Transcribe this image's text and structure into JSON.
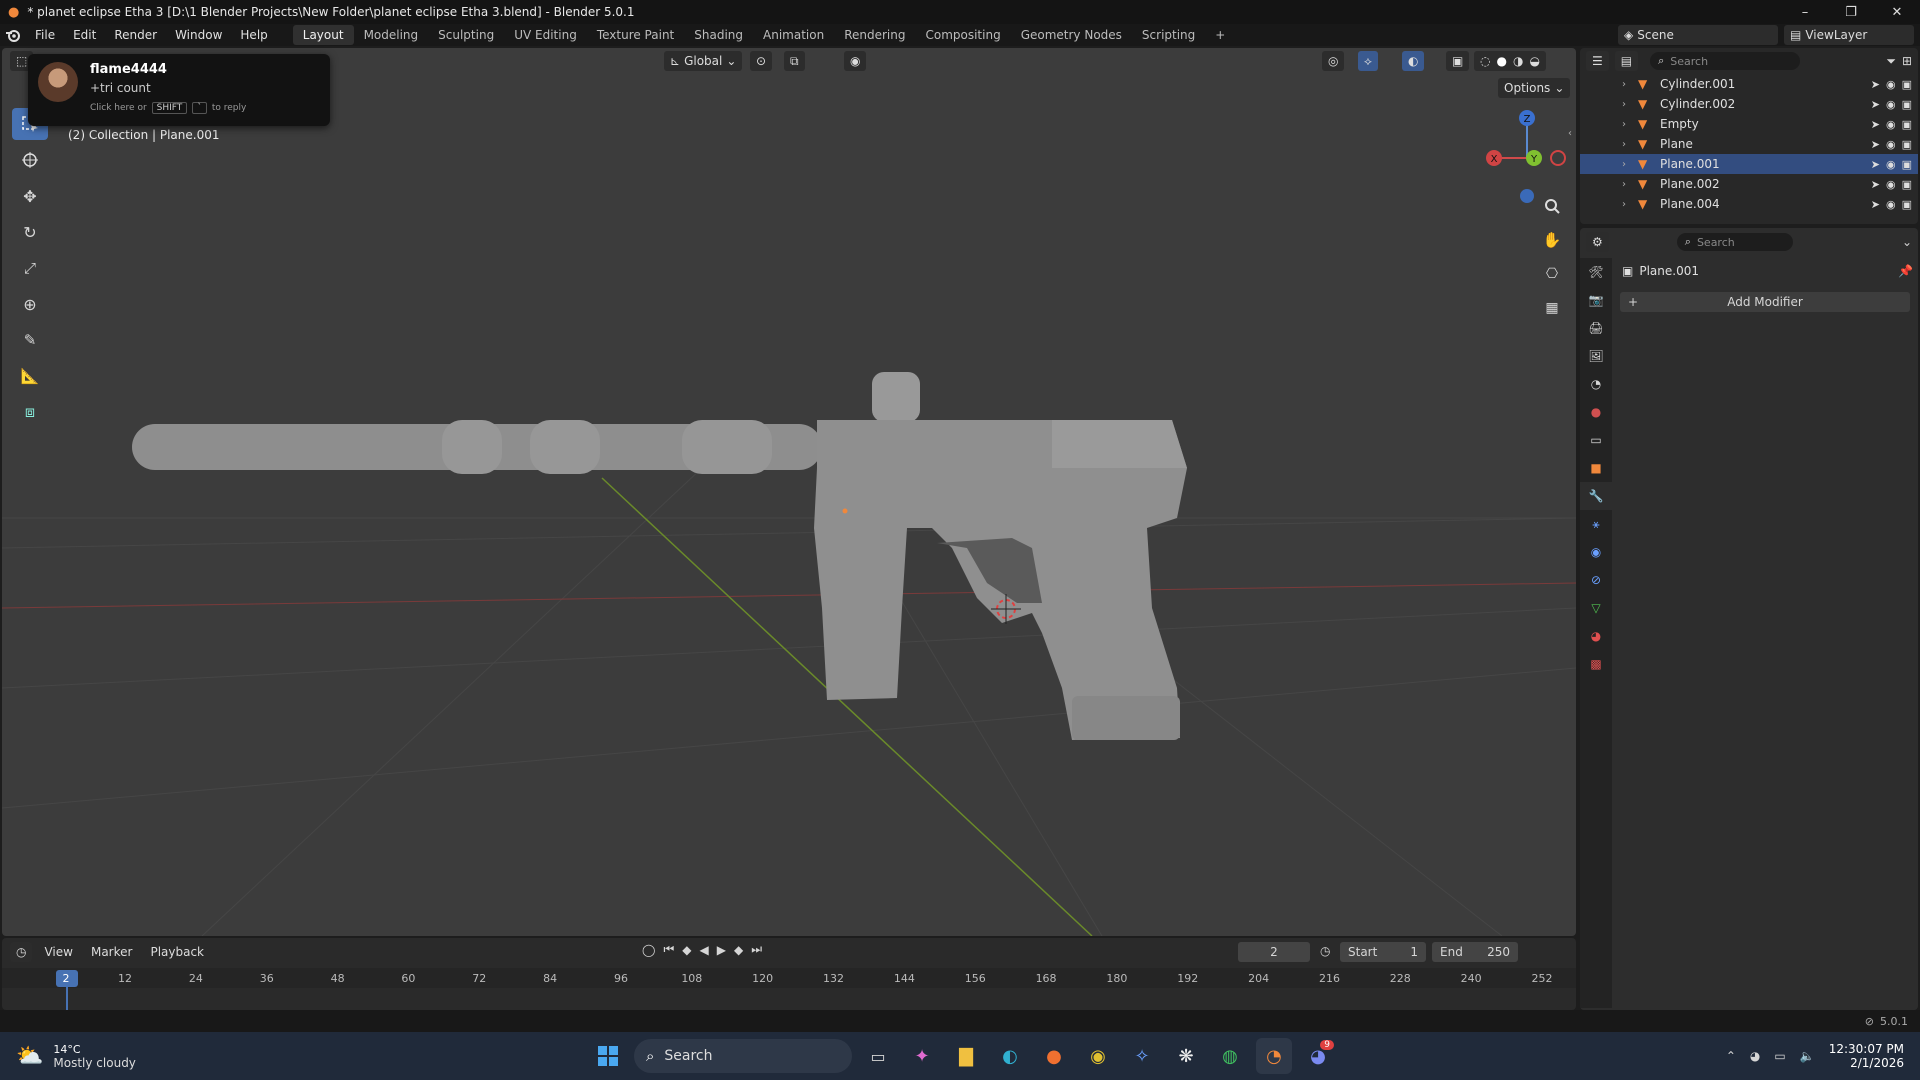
{
  "window": {
    "title": "* planet eclipse Etha 3 [D:\\1 Blender Projects\\New Folder\\planet eclipse Etha 3.blend] - Blender 5.0.1"
  },
  "menu": {
    "items": [
      "File",
      "Edit",
      "Render",
      "Window",
      "Help"
    ]
  },
  "workspaces": {
    "tabs": [
      "Layout",
      "Modeling",
      "Sculpting",
      "UV Editing",
      "Texture Paint",
      "Shading",
      "Animation",
      "Rendering",
      "Compositing",
      "Geometry Nodes",
      "Scripting"
    ],
    "active": "Layout",
    "add": "+"
  },
  "top_right": {
    "scene": "Scene",
    "view_layer": "ViewLayer"
  },
  "viewport": {
    "transform_orientation": "Global",
    "options_label": "Options",
    "info_text": "(2) Collection | Plane.001",
    "gizmo": {
      "x": "X",
      "y": "Y",
      "z": "Z"
    }
  },
  "notification": {
    "user": "flame4444",
    "message": "+tri count",
    "hint_prefix": "Click here or",
    "key1": "SHIFT",
    "key2": "`",
    "hint_suffix": "to reply"
  },
  "outliner": {
    "search_placeholder": "Search",
    "items": [
      {
        "name": "Cylinder.001",
        "selected": false
      },
      {
        "name": "Cylinder.002",
        "selected": false
      },
      {
        "name": "Empty",
        "selected": false
      },
      {
        "name": "Plane",
        "selected": false
      },
      {
        "name": "Plane.001",
        "selected": true
      },
      {
        "name": "Plane.002",
        "selected": false
      },
      {
        "name": "Plane.004",
        "selected": false
      }
    ]
  },
  "properties": {
    "search_placeholder": "Search",
    "object_name": "Plane.001",
    "add_modifier": "Add Modifier"
  },
  "timeline": {
    "menus": [
      "View",
      "Marker",
      "Playback"
    ],
    "current_frame": "2",
    "start_label": "Start",
    "start": "1",
    "end_label": "End",
    "end": "250",
    "ticks": [
      "2",
      "12",
      "24",
      "36",
      "48",
      "60",
      "72",
      "84",
      "96",
      "108",
      "120",
      "132",
      "144",
      "156",
      "168",
      "180",
      "192",
      "204",
      "216",
      "228",
      "240",
      "252"
    ]
  },
  "status": {
    "version": "5.0.1"
  },
  "taskbar": {
    "weather_temp": "14°C",
    "weather_desc": "Mostly cloudy",
    "search": "Search",
    "time": "12:30:07 PM",
    "date": "2/1/2026",
    "discord_badge": "9"
  },
  "colors": {
    "accent": "#4772b3",
    "selected_row": "#334d80",
    "viewport_bg": "#3c3c3c",
    "object_orange": "#f0883c"
  }
}
